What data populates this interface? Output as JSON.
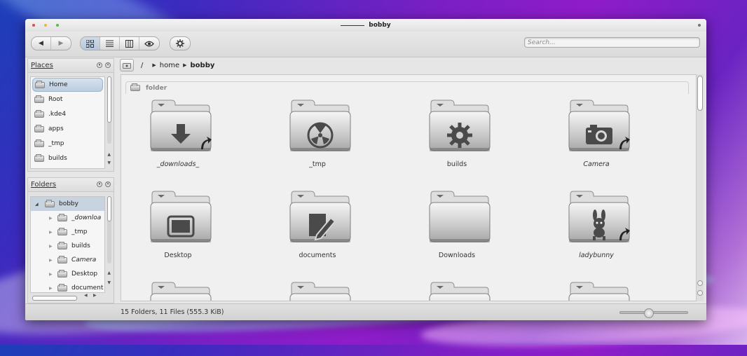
{
  "window": {
    "title": "bobby"
  },
  "toolbar": {
    "back_icon": "◀",
    "forward_icon": "▶",
    "view_icons": [
      "icons-view-icon",
      "details-view-icon",
      "columns-view-icon",
      "preview-eye-icon"
    ],
    "settings_icon": "gear-icon"
  },
  "search": {
    "placeholder": "Search..."
  },
  "places": {
    "title": "Places",
    "items": [
      {
        "label": "Home",
        "selected": true
      },
      {
        "label": "Root"
      },
      {
        "label": ".kde4"
      },
      {
        "label": "apps"
      },
      {
        "label": "_tmp"
      },
      {
        "label": "builds"
      }
    ]
  },
  "folders_panel": {
    "title": "Folders",
    "root": "bobby",
    "children": [
      {
        "label": "_downloa"
      },
      {
        "label": "_tmp"
      },
      {
        "label": "builds"
      },
      {
        "label": "Camera"
      },
      {
        "label": "Desktop"
      },
      {
        "label": "document"
      }
    ]
  },
  "breadcrumb": {
    "root": "/",
    "parts": [
      "home",
      "bobby"
    ]
  },
  "content": {
    "group_label": "folder",
    "folders": [
      {
        "label": "_downloads_",
        "emblem": "download",
        "link": true,
        "italic": true
      },
      {
        "label": "_tmp",
        "emblem": "radiation",
        "link": false,
        "italic": false
      },
      {
        "label": "builds",
        "emblem": "gear",
        "link": false,
        "italic": false
      },
      {
        "label": "Camera",
        "emblem": "camera",
        "link": true,
        "italic": true
      },
      {
        "label": "Desktop",
        "emblem": "screen",
        "link": false,
        "italic": false
      },
      {
        "label": "documents",
        "emblem": "pencil",
        "link": false,
        "italic": false
      },
      {
        "label": "Downloads",
        "emblem": "none",
        "link": false,
        "italic": false
      },
      {
        "label": "ladybunny",
        "emblem": "bunny",
        "link": true,
        "italic": true
      }
    ]
  },
  "status": {
    "text": "15 Folders, 11 Files (555.3 KiB)",
    "zoom_fraction": 0.4
  }
}
